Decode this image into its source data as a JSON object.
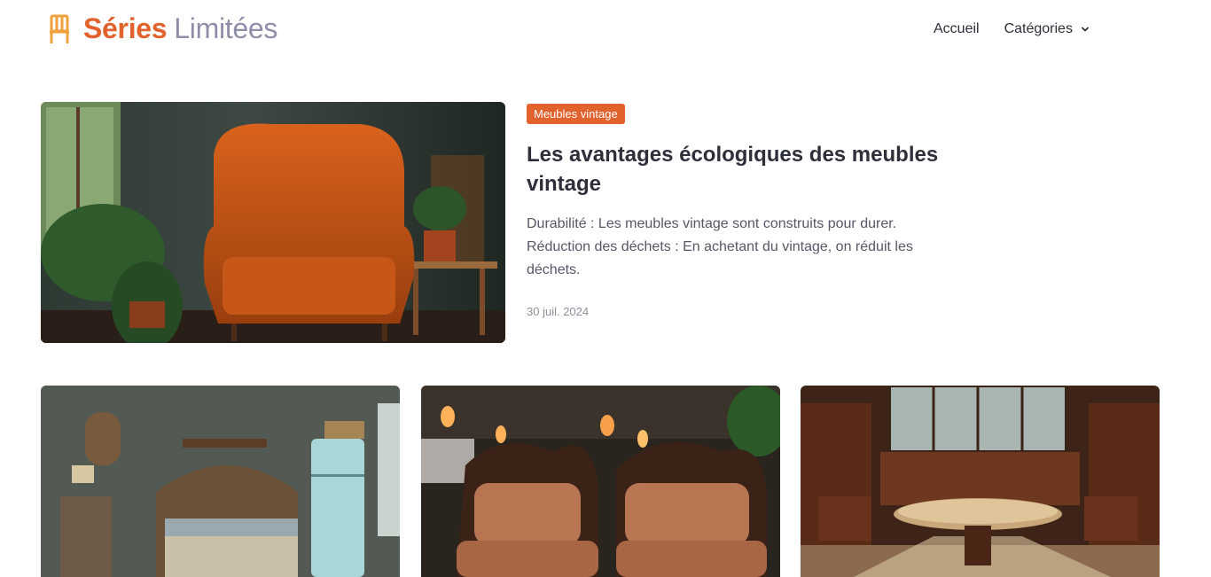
{
  "header": {
    "brand_word1": "Séries",
    "brand_word2": "Limitées",
    "brand_icon": "chair-icon",
    "nav": {
      "home_label": "Accueil",
      "categories_label": "Catégories"
    }
  },
  "featured": {
    "category": "Meubles vintage",
    "title": "Les avantages écologiques des meubles vintage",
    "excerpt": "Durabilité : Les meubles vintage sont construits pour durer. Réduction des déchets : En achetant du vintage, on réduit les déchets.",
    "date": "30 juil. 2024"
  },
  "colors": {
    "brand_accent": "#e2622e",
    "brand_secondary": "#8e8ea8",
    "text_primary": "#2d2f3a"
  }
}
